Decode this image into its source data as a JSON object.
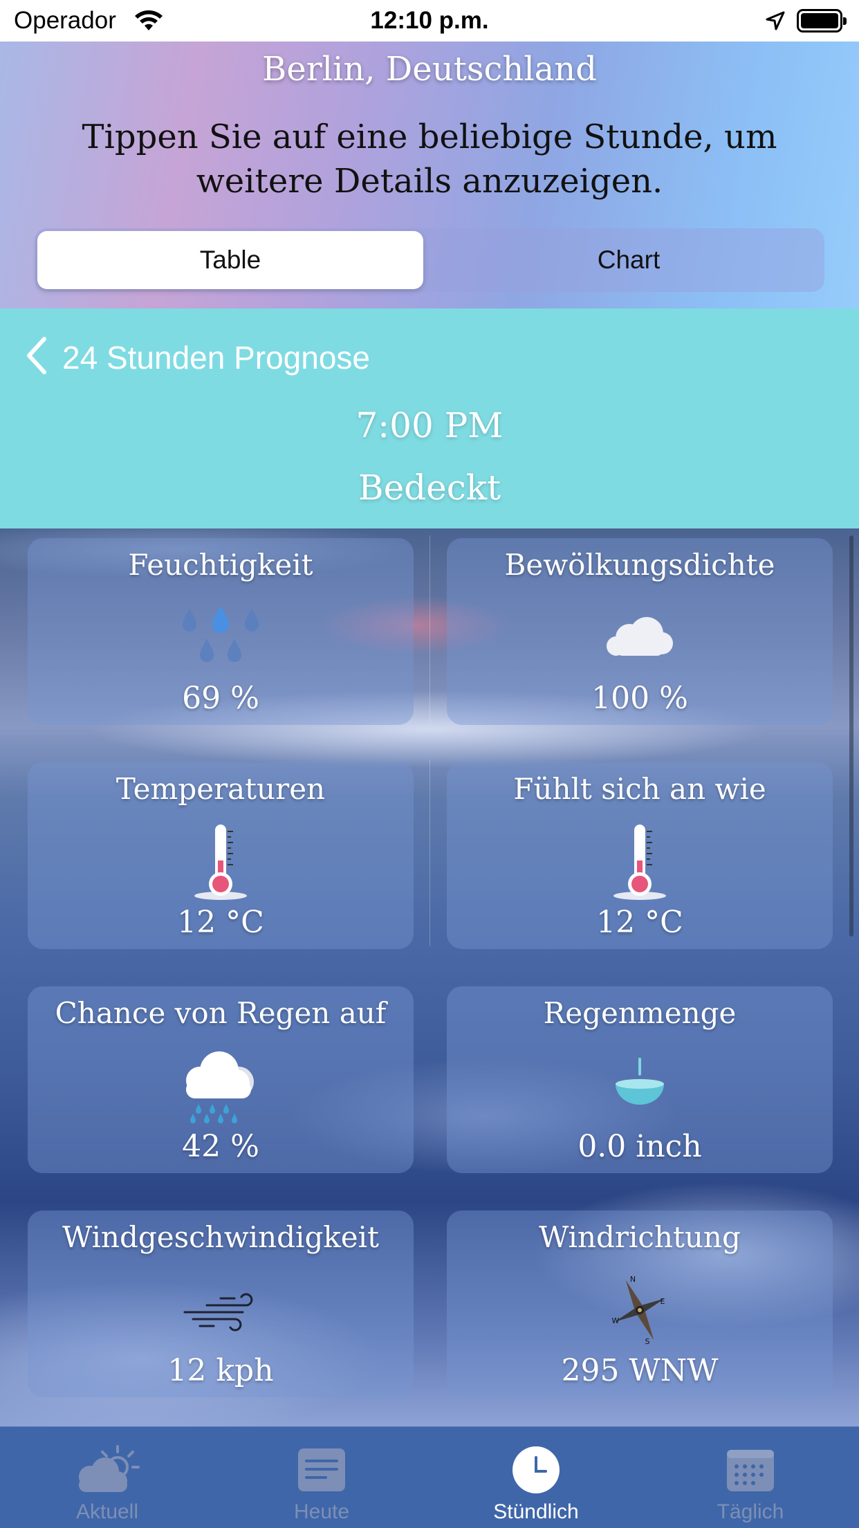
{
  "status_bar": {
    "carrier": "Operador",
    "time": "12:10 p.m."
  },
  "header": {
    "location": "Berlin, Deutschland",
    "hint": "Tippen Sie auf eine beliebige Stunde, um weitere Details anzuzeigen.",
    "segments": [
      {
        "label": "Table",
        "selected": true
      },
      {
        "label": "Chart",
        "selected": false
      }
    ]
  },
  "summary": {
    "back_label": "24 Stunden Prognose",
    "hour": "7:00 PM",
    "condition": "Bedeckt"
  },
  "details": [
    {
      "title": "Feuchtigkeit",
      "value": "69 %",
      "icon": "raindrops-icon"
    },
    {
      "title": "Bewölkungsdichte",
      "value": "100 %",
      "icon": "cloud-icon"
    },
    {
      "title": "Temperaturen",
      "value": "12 °C",
      "icon": "thermometer-icon"
    },
    {
      "title": "Fühlt sich an wie",
      "value": "12 °C",
      "icon": "thermometer-icon"
    },
    {
      "title": "Chance von Regen auf",
      "value": "42 %",
      "icon": "rain-cloud-icon"
    },
    {
      "title": "Regenmenge",
      "value": "0.0 inch",
      "icon": "rain-gauge-icon"
    },
    {
      "title": "Windgeschwindigkeit",
      "value": "12 kph",
      "icon": "wind-icon"
    },
    {
      "title": "Windrichtung",
      "value": "295 WNW",
      "icon": "compass-icon"
    }
  ],
  "tabs": [
    {
      "label": "Aktuell",
      "icon": "partly-cloudy-icon",
      "active": false
    },
    {
      "label": "Heute",
      "icon": "document-icon",
      "active": false
    },
    {
      "label": "Stündlich",
      "icon": "clock-icon",
      "active": true
    },
    {
      "label": "Täglich",
      "icon": "calendar-icon",
      "active": false
    }
  ],
  "colors": {
    "summary_background": "#7fdbe2",
    "tab_bar": "#3f66a8",
    "tab_inactive": "#7d8fb6",
    "tab_active": "#ffffff",
    "thermometer_bulb": "#e8557a",
    "drop_accent": "#4a90e2"
  }
}
